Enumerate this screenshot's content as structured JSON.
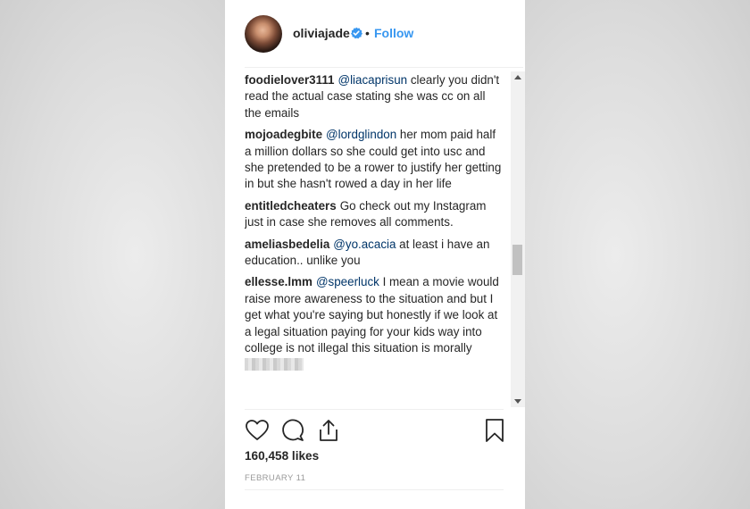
{
  "header": {
    "username": "oliviajade",
    "separator": "•",
    "follow_label": "Follow",
    "avatar_icon": "avatar-photo",
    "verified_icon": "verified-badge-icon"
  },
  "comments": [
    {
      "user": "foodielover3111",
      "mention": "@liacaprisun",
      "text": " clearly you didn't read the actual case stating she was cc on all the emails"
    },
    {
      "user": "mojoadegbite",
      "mention": "@lordglindon",
      "text": " her mom paid half a million dollars so she could get into usc and she pretended to be a rower to justify her getting in but she hasn't rowed a day in her life"
    },
    {
      "user": "entitledcheaters",
      "mention": "",
      "text": "Go check out my Instagram just in case she removes all comments."
    },
    {
      "user": "ameliasbedelia",
      "mention": "@yo.acacia",
      "text": " at least i have an education.. unlike you"
    },
    {
      "user": "ellesse.lmm",
      "mention": "@speerluck",
      "text": " I mean a movie would raise more awareness to the situation and but I get what you're saying but honestly if we look at a legal situation paying for your kids way into college is not illegal this situation is morally "
    }
  ],
  "actions": {
    "like_icon": "heart-icon",
    "comment_icon": "comment-bubble-icon",
    "share_icon": "share-icon",
    "save_icon": "bookmark-icon"
  },
  "likes": "160,458 likes",
  "date": "FEBRUARY 11",
  "colors": {
    "accent": "#3897f0",
    "mention": "#003569",
    "text": "#262626",
    "muted": "#999999"
  }
}
